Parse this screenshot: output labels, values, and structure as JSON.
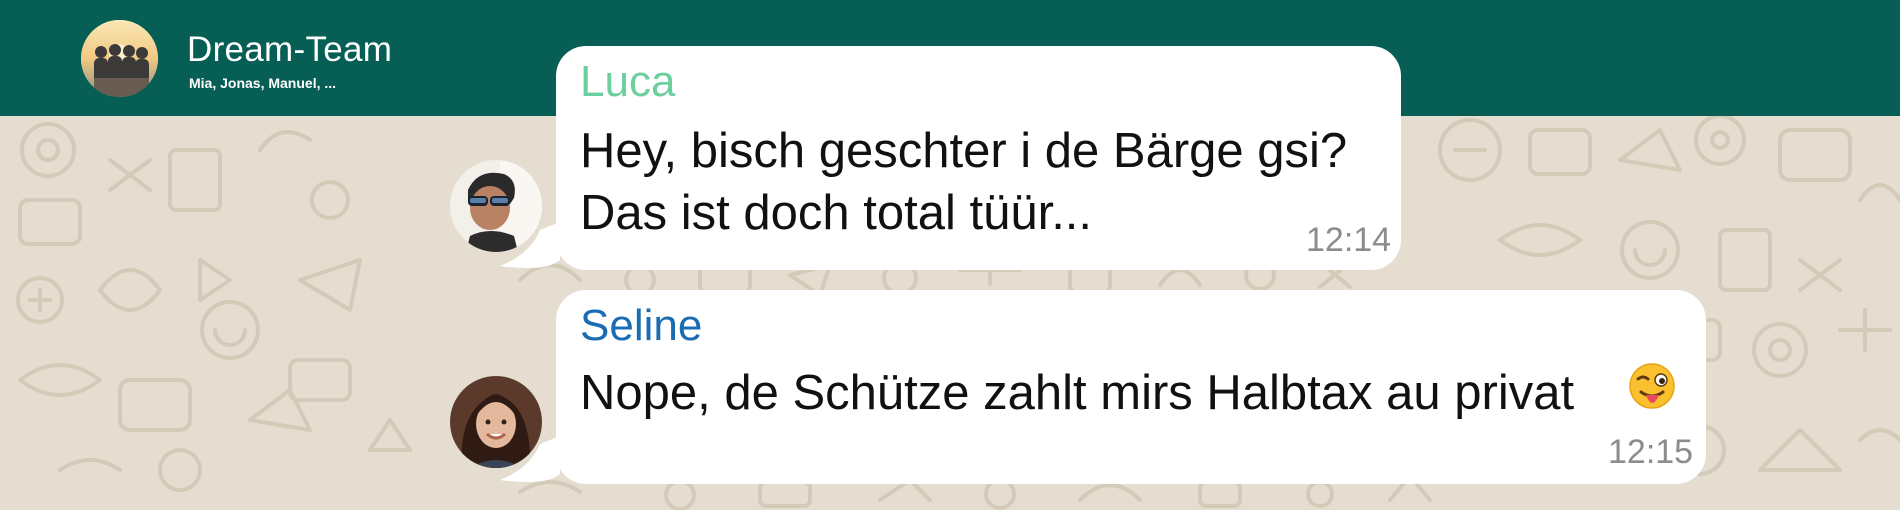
{
  "header": {
    "title": "Dream-Team",
    "members": "Mia, Jonas, Manuel, ..."
  },
  "messages": [
    {
      "sender": "Luca",
      "sender_color": "#6ccf9e",
      "lines": [
        "Hey, bisch geschter i de Bärge gsi?",
        "Das ist doch total tüür..."
      ],
      "time": "12:14"
    },
    {
      "sender": "Seline",
      "sender_color": "#1a6cb3",
      "lines": [
        "Nope, de Schütze zahlt mirs Halbtax au privat"
      ],
      "emoji": "winking-face-with-tongue-icon",
      "time": "12:15"
    }
  ],
  "colors": {
    "header": "#075e55",
    "wallpaper": "#e5ddd0",
    "bubble": "#ffffff"
  }
}
